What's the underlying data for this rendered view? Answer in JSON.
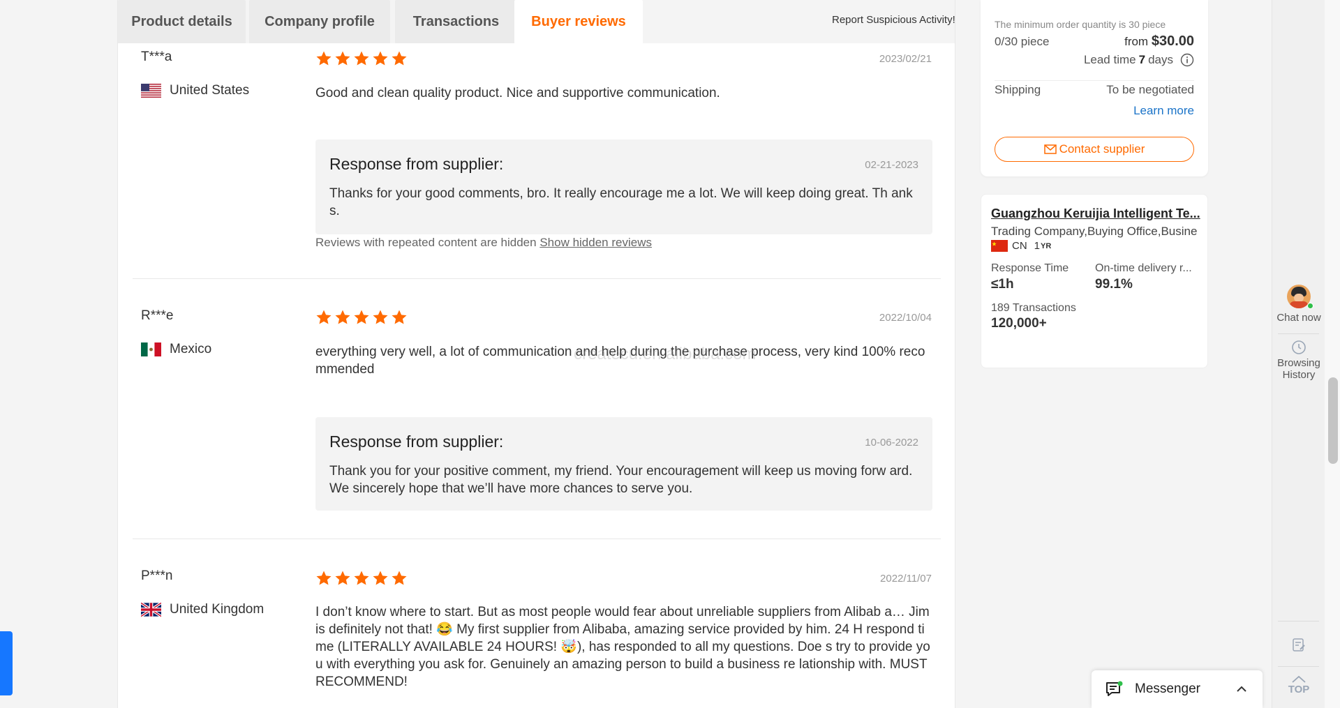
{
  "tabs": [
    {
      "label": "Product details"
    },
    {
      "label": "Company profile"
    },
    {
      "label": "Transactions"
    },
    {
      "label": "Buyer reviews"
    }
  ],
  "report_link": "Report Suspicious Activity!",
  "watermark": "createcu.en.alibaba.com",
  "reviews": [
    {
      "name": "T***a",
      "country": "United States",
      "flag": "us",
      "date": "2023/02/21",
      "rating": 5,
      "text": "Good and clean quality product. Nice and supportive communication.",
      "response_title": "Response from supplier:",
      "response_date": "02-21-2023",
      "response_text": "Thanks for your good comments, bro. It really encourage me a lot. We will keep doing great. Th anks.",
      "hidden_note": "Reviews with repeated content are hidden",
      "hidden_link": "Show hidden reviews"
    },
    {
      "name": "R***e",
      "country": "Mexico",
      "flag": "mx",
      "date": "2022/10/04",
      "rating": 5,
      "text": "everything very well, a lot of communication and help during the purchase process, very kind 100% recommended",
      "response_title": "Response from supplier:",
      "response_date": "10-06-2022",
      "response_text": "Thank you for your positive comment, my friend. Your encouragement will keep us moving forw ard. We sincerely hope that we’ll have more chances to serve you."
    },
    {
      "name": "P***n",
      "country": "United Kingdom",
      "flag": "gb",
      "date": "2022/11/07",
      "rating": 5,
      "text": "I don’t know where to start. But as most people would fear about unreliable suppliers from Alibab a… Jim is definitely not that! 😂 My first supplier from Alibaba, amazing service provided by him. 24 H respond time (LITERALLY AVAILABLE 24 HOURS! 🤯), has responded to all my questions. Doe s try to provide you with everything you ask for. Genuinely an amazing person to build a business re lationship with. MUST RECOMMEND!"
    }
  ],
  "order": {
    "moq_note": "The minimum order quantity is 30 piece",
    "quantity": "0/30 piece",
    "price_prefix": "from",
    "price": "$30.00",
    "lead_time_label": "Lead time",
    "lead_time_value": "7",
    "lead_time_unit": "days",
    "shipping_label": "Shipping",
    "shipping_value": "To be negotiated",
    "learn_more": "Learn more",
    "contact_label": "Contact supplier"
  },
  "supplier": {
    "name": "Guangzhou Keruijia Intelligent Te...",
    "type": "Trading Company,Buying Office,Busine",
    "country_code": "CN",
    "years": "1",
    "years_unit": "YR",
    "response_time_label": "Response Time",
    "response_time_value": "≤1h",
    "ontime_label": "On-time delivery r...",
    "ontime_value": "99.1%",
    "transactions_label": "189 Transactions",
    "transactions_value": "120,000+"
  },
  "toolbar": {
    "chat_label": "Chat now",
    "history_label_1": "Browsing",
    "history_label_2": "History",
    "top_label": "TOP"
  },
  "messenger": {
    "label": "Messenger"
  },
  "colors": {
    "accent": "#ff6a00",
    "link": "#1a73c8",
    "star": "#ff6a00"
  }
}
